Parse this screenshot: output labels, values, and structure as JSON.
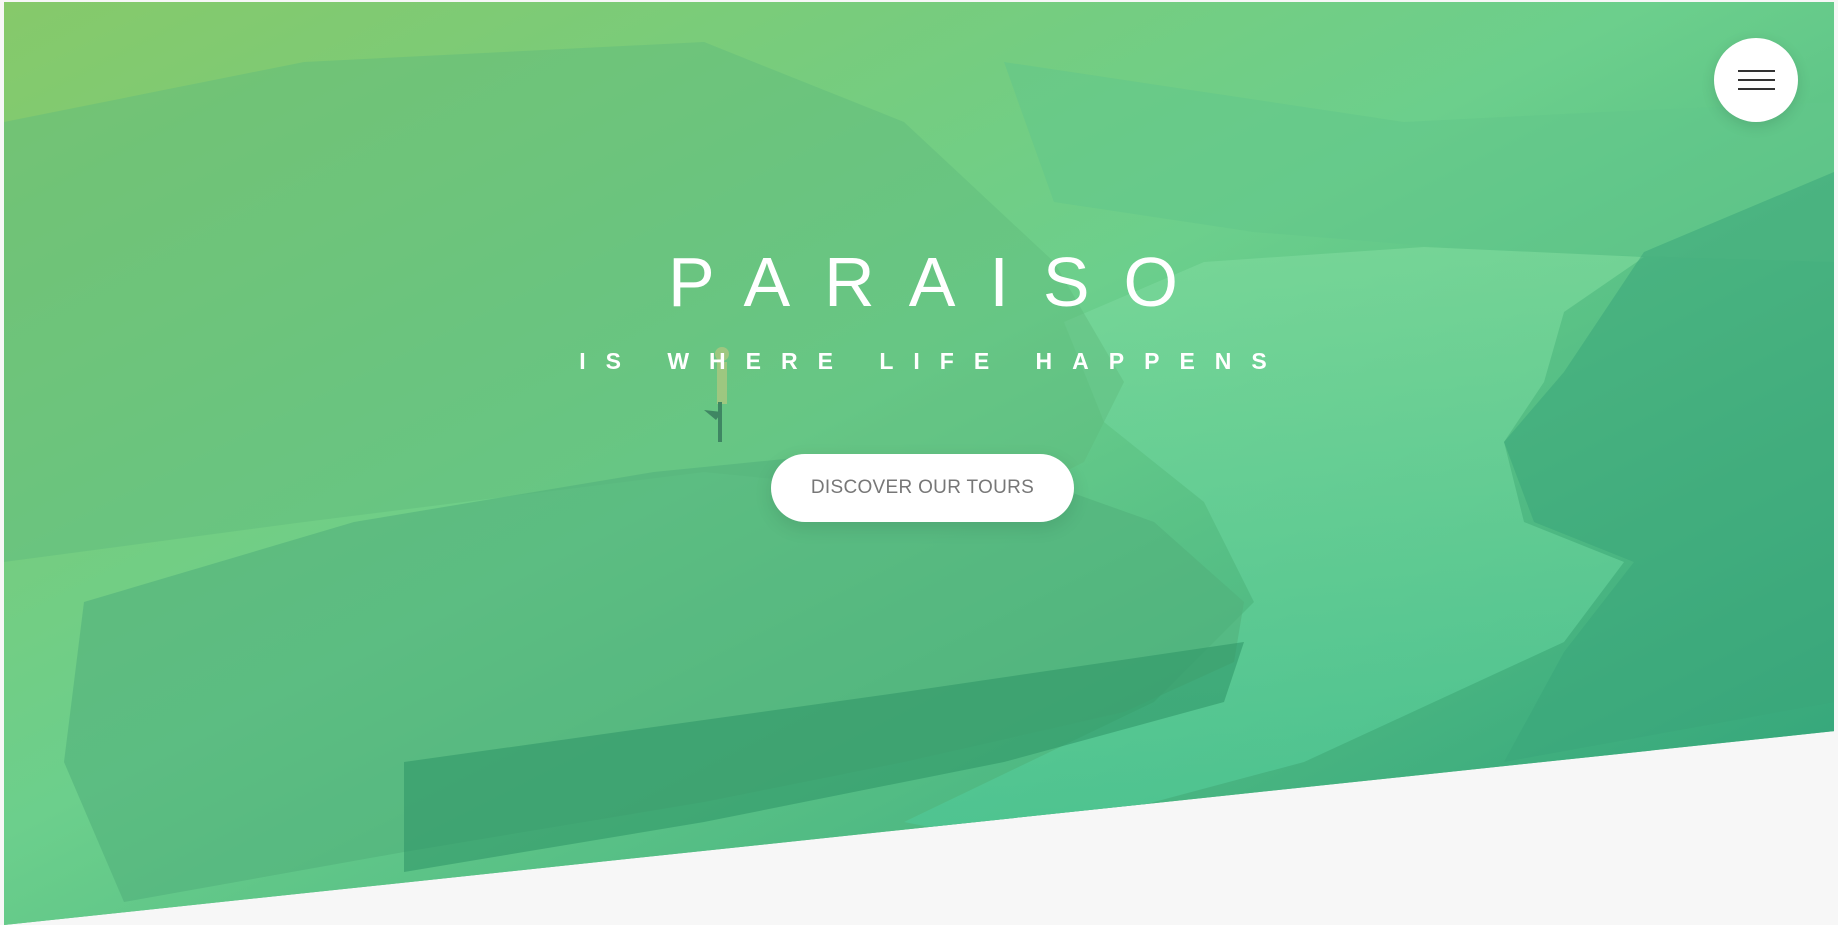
{
  "hero": {
    "title": "PARAISO",
    "subtitle": "IS WHERE LIFE HAPPENS",
    "cta_label": "DISCOVER OUR TOURS",
    "background_icon": "mountain-fjord-landscape",
    "overlay_colors": [
      "#7ed56f",
      "#28b485"
    ]
  },
  "navigation": {
    "menu_icon": "hamburger-menu-icon"
  },
  "colors": {
    "page_background": "#f7f7f7",
    "title_text": "#ffffff",
    "button_background": "#ffffff",
    "button_text": "#777777"
  }
}
